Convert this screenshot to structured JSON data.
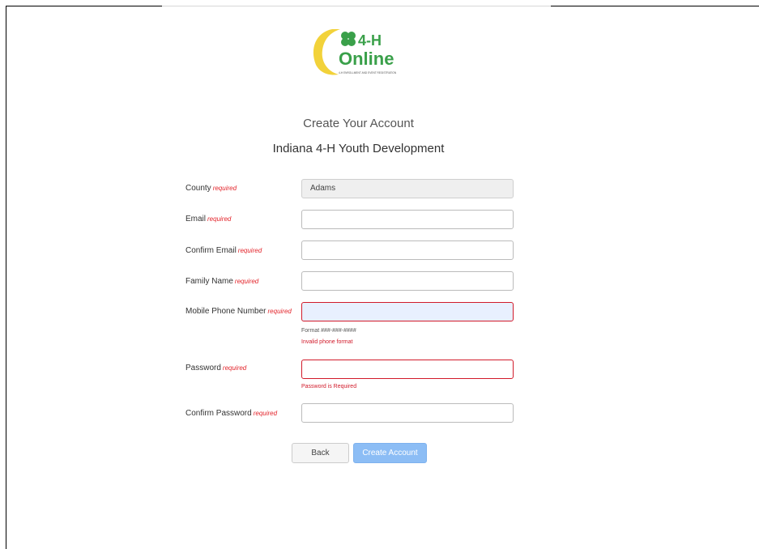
{
  "header": {
    "logo_text": "4-H",
    "logo_subtext": "Online",
    "logo_tagline": "4-H ENROLLMENT AND EVENT REGISTRATION",
    "title": "Create Your Account",
    "subtitle": "Indiana 4-H Youth Development"
  },
  "form": {
    "required_label": "required",
    "county": {
      "label": "County",
      "value": "Adams"
    },
    "email": {
      "label": "Email",
      "value": ""
    },
    "confirm_email": {
      "label": "Confirm Email",
      "value": ""
    },
    "family_name": {
      "label": "Family Name",
      "value": ""
    },
    "mobile_phone": {
      "label": "Mobile Phone Number",
      "value": "",
      "hint": "Format ###-###-####",
      "error": "Invalid phone format"
    },
    "password": {
      "label": "Password",
      "value": "",
      "error": "Password is Required"
    },
    "confirm_password": {
      "label": "Confirm Password",
      "value": ""
    }
  },
  "buttons": {
    "back": "Back",
    "create": "Create Account"
  },
  "colors": {
    "required": "#e3242b",
    "error_border": "#d11a2a",
    "primary_disabled": "#8cbdf5",
    "logo_green": "#3aa04a",
    "logo_yellow": "#f2d23a"
  }
}
